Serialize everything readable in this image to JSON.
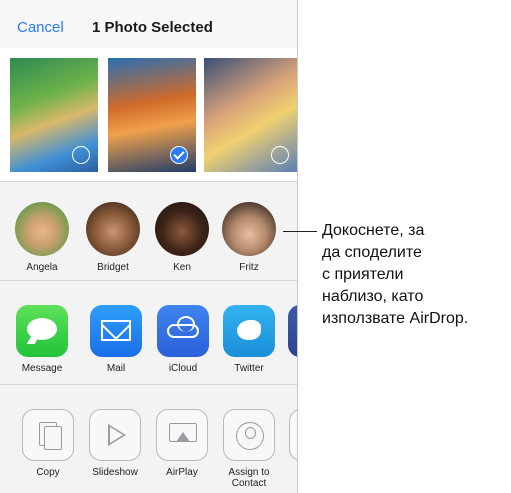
{
  "header": {
    "cancel_label": "Cancel",
    "title": "1 Photo Selected"
  },
  "photos": [
    {
      "selected": false
    },
    {
      "selected": true
    },
    {
      "selected": false
    }
  ],
  "airdrop": {
    "people": [
      {
        "name": "Angela"
      },
      {
        "name": "Bridget"
      },
      {
        "name": "Ken"
      },
      {
        "name": "Fritz"
      }
    ]
  },
  "share_apps": [
    {
      "label": "Message",
      "icon": "message-icon",
      "color": "#2fce45"
    },
    {
      "label": "Mail",
      "icon": "mail-icon",
      "color": "#1f86f0"
    },
    {
      "label": "iCloud",
      "icon": "icloud-icon",
      "color": "#3474e6"
    },
    {
      "label": "Twitter",
      "icon": "twitter-icon",
      "color": "#22a2e6"
    }
  ],
  "actions": [
    {
      "label": "Copy",
      "icon": "copy-icon"
    },
    {
      "label": "Slideshow",
      "icon": "slideshow-icon"
    },
    {
      "label": "AirPlay",
      "icon": "airplay-icon"
    },
    {
      "label_line1": "Assign to",
      "label_line2": "Contact",
      "icon": "contact-icon"
    }
  ],
  "callout": {
    "lines": [
      "Докоснете, за",
      "да споделите",
      "с приятели",
      "наблизо, като",
      "използвате AirDrop."
    ]
  },
  "colors": {
    "accent": "#2a7bf6"
  }
}
